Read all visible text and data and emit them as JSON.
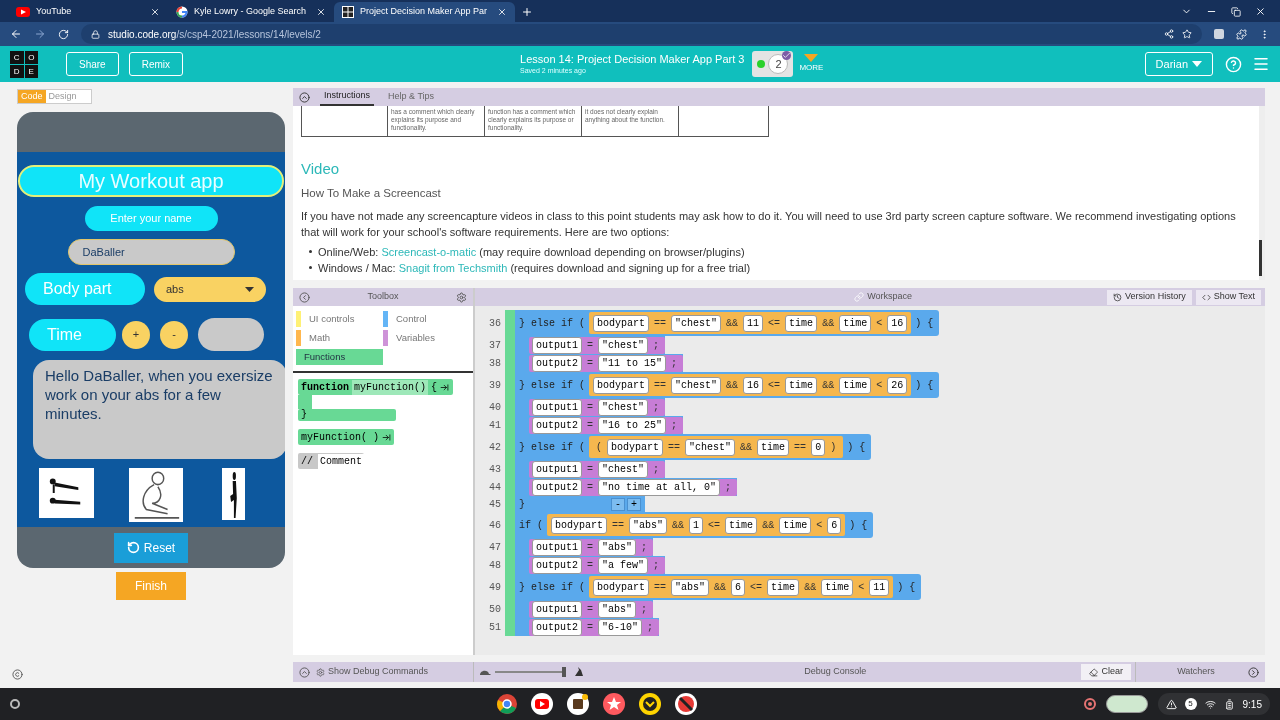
{
  "browser": {
    "tabs": [
      {
        "title": "YouTube",
        "selected": false
      },
      {
        "title": "Kyle Lowry - Google Search",
        "selected": false
      },
      {
        "title": "Project Decision Maker App Par",
        "selected": true
      }
    ],
    "url_host": "studio.code.org",
    "url_path": "/s/csp4-2021/lessons/14/levels/2"
  },
  "header": {
    "logo_letters": [
      "C",
      "O",
      "D",
      "E"
    ],
    "buttons": [
      "Share",
      "Remix"
    ],
    "lesson_title": "Lesson 14: Project Decision Maker App Part 3",
    "saved": "Saved 2 minutes ago",
    "progress_level": "2",
    "more": "MORE",
    "user": "Darian"
  },
  "mode_toggle": [
    {
      "label": "Code",
      "selected": true
    },
    {
      "label": "Design",
      "selected": false
    }
  ],
  "app": {
    "title": "My Workout app",
    "name_label": "Enter your name",
    "name_value": "DaBaller",
    "body_label": "Body part",
    "body_value": "abs",
    "time_label": "Time",
    "plus": "+",
    "minus": "-",
    "message": "Hello DaBaller, when you exersize work on your abs for a few minutes.",
    "reset": "Reset",
    "finish": "Finish"
  },
  "instructions": {
    "tabs": [
      {
        "label": "Instructions",
        "selected": true
      },
      {
        "label": "Help & Tips",
        "selected": false
      }
    ],
    "table_cells": [
      "has a comment which clearly explains its purpose and functionality.",
      "function has a comment which clearly explains its purpose or functionality.",
      "it does not clearly explain anything about the function."
    ],
    "heading": "Video",
    "subheading": "How To Make a Screencast",
    "paragraph": "If you have not made any screencapture videos in class to this point students may ask how to do it. You will need to use 3rd party screen capture software. We recommend investigating options that will work for your school's software requirements. Here are two options:",
    "options": [
      {
        "prefix": "Online/Web:",
        "link": "Screencast-o-matic",
        "suffix": "(may require download depending on browser/plugins)"
      },
      {
        "prefix": "Windows / Mac:",
        "link": "Snagit from Techsmith",
        "suffix": "(requires download and signing up for a free trial)"
      }
    ]
  },
  "toolbox": {
    "title": "Toolbox",
    "categories": [
      {
        "name": "UI controls",
        "color": "#fff176",
        "selected": false
      },
      {
        "name": "Control",
        "color": "#64b5f6",
        "selected": false
      },
      {
        "name": "Math",
        "color": "#ffb74d",
        "selected": false
      },
      {
        "name": "Variables",
        "color": "#ce93d8",
        "selected": false
      },
      {
        "name": "Functions",
        "color": "#68d995",
        "selected": true
      }
    ],
    "blocks": [
      {
        "kind": "definition",
        "keyword": "function",
        "name": "myFunction()",
        "brace": "{",
        "close": "}"
      },
      {
        "kind": "call",
        "text": "myFunction( )"
      },
      {
        "kind": "comment",
        "slashes": "//",
        "text": "Comment"
      }
    ]
  },
  "workspace": {
    "title": "Workspace",
    "buttons": [
      "Version History",
      "Show Text"
    ],
    "lines": [
      {
        "number": "36",
        "kind": "control",
        "prefix": "} else if (",
        "condition": [
          {
            "kind": "field",
            "text": "bodypart"
          },
          {
            "kind": "op",
            "text": "=="
          },
          {
            "kind": "field",
            "text": "\"chest\""
          },
          {
            "kind": "op",
            "text": "&&"
          },
          {
            "kind": "field",
            "text": "11"
          },
          {
            "kind": "op",
            "text": "<="
          },
          {
            "kind": "field",
            "text": "time"
          },
          {
            "kind": "op",
            "text": "&&"
          },
          {
            "kind": "field",
            "text": "time"
          },
          {
            "kind": "op",
            "text": "<"
          },
          {
            "kind": "field",
            "text": "16"
          }
        ],
        "suffix": ") {"
      },
      {
        "number": "37",
        "kind": "assign",
        "target": "output1",
        "op": "=",
        "value": "\"chest\"",
        "end": ";"
      },
      {
        "number": "38",
        "kind": "assign",
        "target": "output2",
        "op": "=",
        "value": "\"11 to 15\"",
        "end": ";"
      },
      {
        "number": "39",
        "kind": "control",
        "prefix": "} else if (",
        "condition": [
          {
            "kind": "field",
            "text": "bodypart"
          },
          {
            "kind": "op",
            "text": "=="
          },
          {
            "kind": "field",
            "text": "\"chest\""
          },
          {
            "kind": "op",
            "text": "&&"
          },
          {
            "kind": "field",
            "text": "16"
          },
          {
            "kind": "op",
            "text": "<="
          },
          {
            "kind": "field",
            "text": "time"
          },
          {
            "kind": "op",
            "text": "&&"
          },
          {
            "kind": "field",
            "text": "time"
          },
          {
            "kind": "op",
            "text": "<"
          },
          {
            "kind": "field",
            "text": "26"
          }
        ],
        "suffix": ") {"
      },
      {
        "number": "40",
        "kind": "assign",
        "target": "output1",
        "op": "=",
        "value": "\"chest\"",
        "end": ";"
      },
      {
        "number": "41",
        "kind": "assign",
        "target": "output2",
        "op": "=",
        "value": "\"16 to 25\"",
        "end": ";"
      },
      {
        "number": "42",
        "kind": "control",
        "prefix": "} else if (",
        "condition": [
          {
            "kind": "op",
            "text": "("
          },
          {
            "kind": "field",
            "text": "bodypart"
          },
          {
            "kind": "op",
            "text": "=="
          },
          {
            "kind": "field",
            "text": "\"chest\""
          },
          {
            "kind": "op",
            "text": "&&"
          },
          {
            "kind": "field",
            "text": "time"
          },
          {
            "kind": "op",
            "text": "=="
          },
          {
            "kind": "field",
            "text": "0"
          },
          {
            "kind": "op",
            "text": ")"
          }
        ],
        "suffix": ") {"
      },
      {
        "number": "43",
        "kind": "assign",
        "target": "output1",
        "op": "=",
        "value": "\"chest\"",
        "end": ";"
      },
      {
        "number": "44",
        "kind": "assign",
        "target": "output2",
        "op": "=",
        "value": "\"no time at all, 0\"",
        "end": ";"
      },
      {
        "number": "45",
        "kind": "close",
        "text": "}",
        "toggles": [
          "-",
          "+"
        ]
      },
      {
        "number": "46",
        "kind": "control",
        "prefix": "if (",
        "condition": [
          {
            "kind": "field",
            "text": "bodypart"
          },
          {
            "kind": "op",
            "text": "=="
          },
          {
            "kind": "field",
            "text": "\"abs\""
          },
          {
            "kind": "op",
            "text": "&&"
          },
          {
            "kind": "field",
            "text": "1"
          },
          {
            "kind": "op",
            "text": "<="
          },
          {
            "kind": "field",
            "text": "time"
          },
          {
            "kind": "op",
            "text": "&&"
          },
          {
            "kind": "field",
            "text": "time"
          },
          {
            "kind": "op",
            "text": "<"
          },
          {
            "kind": "field",
            "text": "6"
          }
        ],
        "suffix": ") {"
      },
      {
        "number": "47",
        "kind": "assign",
        "target": "output1",
        "op": "=",
        "value": "\"abs\"",
        "end": ";"
      },
      {
        "number": "48",
        "kind": "assign",
        "target": "output2",
        "op": "=",
        "value": "\"a few\"",
        "end": ";"
      },
      {
        "number": "49",
        "kind": "control",
        "prefix": "} else if (",
        "condition": [
          {
            "kind": "field",
            "text": "bodypart"
          },
          {
            "kind": "op",
            "text": "=="
          },
          {
            "kind": "field",
            "text": "\"abs\""
          },
          {
            "kind": "op",
            "text": "&&"
          },
          {
            "kind": "field",
            "text": "6"
          },
          {
            "kind": "op",
            "text": "<="
          },
          {
            "kind": "field",
            "text": "time"
          },
          {
            "kind": "op",
            "text": "&&"
          },
          {
            "kind": "field",
            "text": "time"
          },
          {
            "kind": "op",
            "text": "<"
          },
          {
            "kind": "field",
            "text": "11"
          }
        ],
        "suffix": ") {"
      },
      {
        "number": "50",
        "kind": "assign",
        "target": "output1",
        "op": "=",
        "value": "\"abs\"",
        "end": ";"
      },
      {
        "number": "51",
        "kind": "assign",
        "target": "output2",
        "op": "=",
        "value": "\"6-10\"",
        "end": ";"
      }
    ]
  },
  "debug": {
    "show_commands": "Show Debug Commands",
    "speed": {
      "level": 1
    },
    "console": "Debug Console",
    "clear": "Clear",
    "watchers": "Watchers"
  },
  "taskbar": {
    "notifications": "5",
    "time": "9:15"
  }
}
